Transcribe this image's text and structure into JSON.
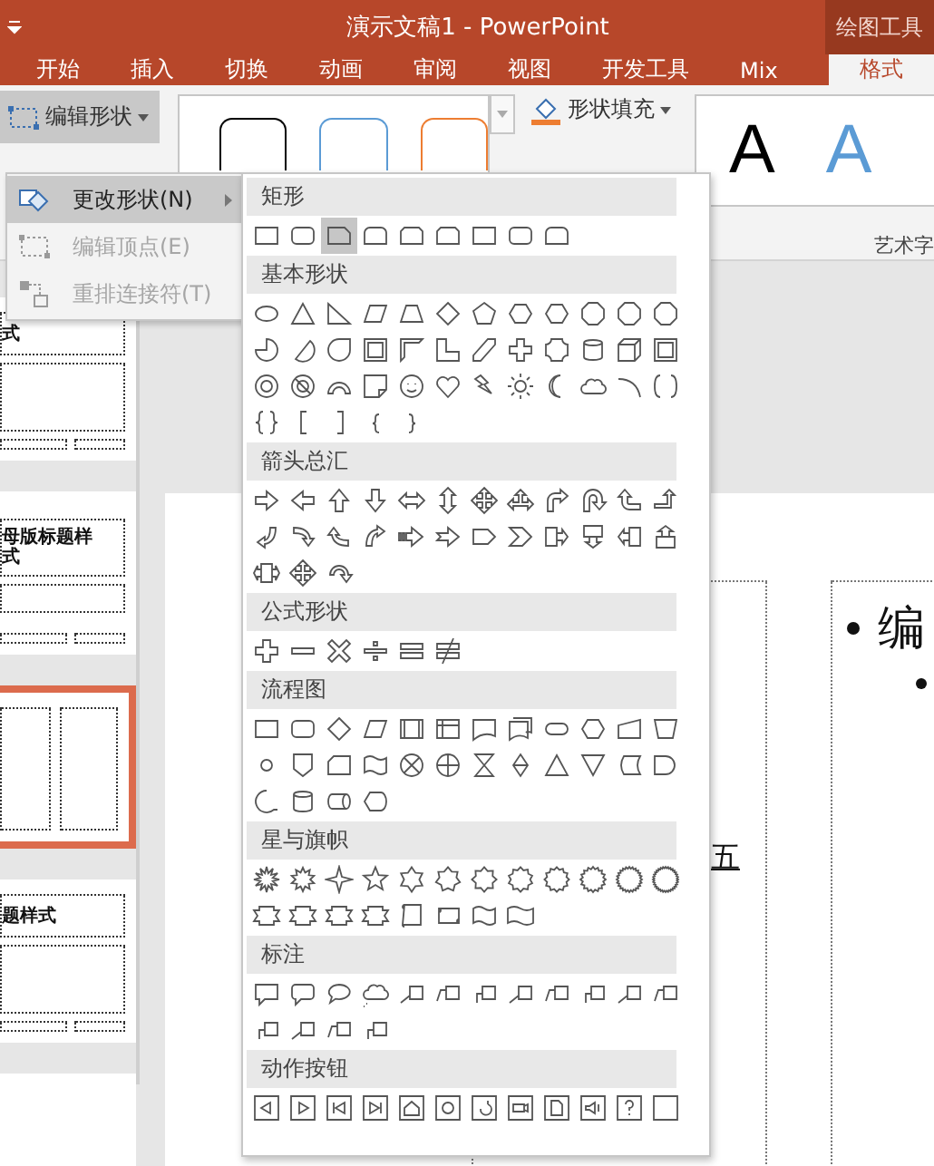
{
  "window": {
    "title": "演示文稿1  -  PowerPoint",
    "context_label": "绘图工具"
  },
  "tabs": [
    {
      "label": "开始",
      "selected": false
    },
    {
      "label": "插入",
      "selected": false
    },
    {
      "label": "切换",
      "selected": false
    },
    {
      "label": "动画",
      "selected": false
    },
    {
      "label": "审阅",
      "selected": false
    },
    {
      "label": "视图",
      "selected": false
    },
    {
      "label": "开发工具",
      "selected": false
    },
    {
      "label": "Mix",
      "selected": false
    },
    {
      "label": "格式",
      "selected": true
    }
  ],
  "ribbon": {
    "edit_shape": {
      "label": "编辑形状",
      "pressed": true
    },
    "shape_styles": [
      {
        "color": "#000000"
      },
      {
        "color": "#5b9bd5"
      },
      {
        "color": "#ed7d31"
      }
    ],
    "shape_fill": {
      "label": "形状填充"
    },
    "wordart": [
      {
        "label": "A",
        "color": "#000000"
      },
      {
        "label": "A",
        "color": "#5b9bd5"
      }
    ],
    "wordart_group_label": "艺术字"
  },
  "edit_menu": [
    {
      "label": "更改形状(N)",
      "selected": true,
      "disabled": false,
      "submenu": true
    },
    {
      "label": "编辑顶点(E)",
      "selected": false,
      "disabled": true,
      "submenu": false
    },
    {
      "label": "重排连接符(T)",
      "selected": false,
      "disabled": true,
      "submenu": false
    }
  ],
  "shape_gallery": [
    {
      "title": "矩形",
      "shapes": [
        {
          "selected": false
        },
        {
          "selected": false
        },
        {
          "selected": true
        },
        {
          "selected": false
        },
        {
          "selected": false
        },
        {
          "selected": false
        },
        {
          "selected": false
        },
        {
          "selected": false
        },
        {
          "selected": false
        }
      ]
    },
    {
      "title": "基本形状",
      "shapes": [
        {
          "selected": false
        },
        {
          "selected": false
        },
        {
          "selected": false
        },
        {
          "selected": false
        },
        {
          "selected": false
        },
        {
          "selected": false
        },
        {
          "selected": false
        },
        {
          "selected": false
        },
        {
          "selected": false
        },
        {
          "selected": false
        },
        {
          "selected": false
        },
        {
          "selected": false
        },
        {
          "selected": false
        },
        {
          "selected": false
        },
        {
          "selected": false
        },
        {
          "selected": false
        },
        {
          "selected": false
        },
        {
          "selected": false
        },
        {
          "selected": false
        },
        {
          "selected": false
        },
        {
          "selected": false
        },
        {
          "selected": false
        },
        {
          "selected": false
        },
        {
          "selected": false
        },
        {
          "selected": false
        },
        {
          "selected": false
        },
        {
          "selected": false
        },
        {
          "selected": false
        },
        {
          "selected": false
        },
        {
          "selected": false
        },
        {
          "selected": false
        },
        {
          "selected": false
        },
        {
          "selected": false
        },
        {
          "selected": false
        },
        {
          "selected": false
        },
        {
          "selected": false
        },
        {
          "selected": false
        },
        {
          "selected": false
        },
        {
          "selected": false
        },
        {
          "selected": false
        },
        {
          "selected": false
        }
      ]
    },
    {
      "title": "箭头总汇",
      "shapes": [
        {
          "selected": false
        },
        {
          "selected": false
        },
        {
          "selected": false
        },
        {
          "selected": false
        },
        {
          "selected": false
        },
        {
          "selected": false
        },
        {
          "selected": false
        },
        {
          "selected": false
        },
        {
          "selected": false
        },
        {
          "selected": false
        },
        {
          "selected": false
        },
        {
          "selected": false
        },
        {
          "selected": false
        },
        {
          "selected": false
        },
        {
          "selected": false
        },
        {
          "selected": false
        },
        {
          "selected": false
        },
        {
          "selected": false
        },
        {
          "selected": false
        },
        {
          "selected": false
        },
        {
          "selected": false
        },
        {
          "selected": false
        },
        {
          "selected": false
        },
        {
          "selected": false
        },
        {
          "selected": false
        },
        {
          "selected": false
        },
        {
          "selected": false
        }
      ]
    },
    {
      "title": "公式形状",
      "shapes": [
        {
          "selected": false
        },
        {
          "selected": false
        },
        {
          "selected": false
        },
        {
          "selected": false
        },
        {
          "selected": false
        },
        {
          "selected": false
        }
      ]
    },
    {
      "title": "流程图",
      "shapes": [
        {
          "selected": false
        },
        {
          "selected": false
        },
        {
          "selected": false
        },
        {
          "selected": false
        },
        {
          "selected": false
        },
        {
          "selected": false
        },
        {
          "selected": false
        },
        {
          "selected": false
        },
        {
          "selected": false
        },
        {
          "selected": false
        },
        {
          "selected": false
        },
        {
          "selected": false
        },
        {
          "selected": false
        },
        {
          "selected": false
        },
        {
          "selected": false
        },
        {
          "selected": false
        },
        {
          "selected": false
        },
        {
          "selected": false
        },
        {
          "selected": false
        },
        {
          "selected": false
        },
        {
          "selected": false
        },
        {
          "selected": false
        },
        {
          "selected": false
        },
        {
          "selected": false
        },
        {
          "selected": false
        },
        {
          "selected": false
        },
        {
          "selected": false
        },
        {
          "selected": false
        }
      ]
    },
    {
      "title": "星与旗帜",
      "shapes": [
        {
          "selected": false
        },
        {
          "selected": false
        },
        {
          "selected": false
        },
        {
          "selected": false
        },
        {
          "selected": false
        },
        {
          "selected": false
        },
        {
          "selected": false
        },
        {
          "selected": false
        },
        {
          "selected": false
        },
        {
          "selected": false
        },
        {
          "selected": false
        },
        {
          "selected": false
        },
        {
          "selected": false
        },
        {
          "selected": false
        },
        {
          "selected": false
        },
        {
          "selected": false
        },
        {
          "selected": false
        },
        {
          "selected": false
        },
        {
          "selected": false
        },
        {
          "selected": false
        }
      ]
    },
    {
      "title": "标注",
      "shapes": [
        {
          "selected": false
        },
        {
          "selected": false
        },
        {
          "selected": false
        },
        {
          "selected": false
        },
        {
          "selected": false
        },
        {
          "selected": false
        },
        {
          "selected": false
        },
        {
          "selected": false
        },
        {
          "selected": false
        },
        {
          "selected": false
        },
        {
          "selected": false
        },
        {
          "selected": false
        },
        {
          "selected": false
        },
        {
          "selected": false
        },
        {
          "selected": false
        },
        {
          "selected": false
        }
      ]
    },
    {
      "title": "动作按钮",
      "shapes": [
        {
          "selected": false
        },
        {
          "selected": false
        },
        {
          "selected": false
        },
        {
          "selected": false
        },
        {
          "selected": false
        },
        {
          "selected": false
        },
        {
          "selected": false
        },
        {
          "selected": false
        },
        {
          "selected": false
        },
        {
          "selected": false
        },
        {
          "selected": false
        },
        {
          "selected": false
        }
      ]
    }
  ],
  "thumbnails": [
    {
      "kind": "title-content",
      "lines": [
        "式"
      ],
      "selected": false
    },
    {
      "kind": "title",
      "lines": [
        "母版标题样",
        "式"
      ],
      "selected": false
    },
    {
      "kind": "two-content",
      "selected": true
    },
    {
      "kind": "title-content",
      "lines": [
        "题样式"
      ],
      "selected": false
    },
    {
      "kind": "blank",
      "selected": false
    }
  ],
  "slide": {
    "left_text": "五",
    "right_text": "编"
  }
}
